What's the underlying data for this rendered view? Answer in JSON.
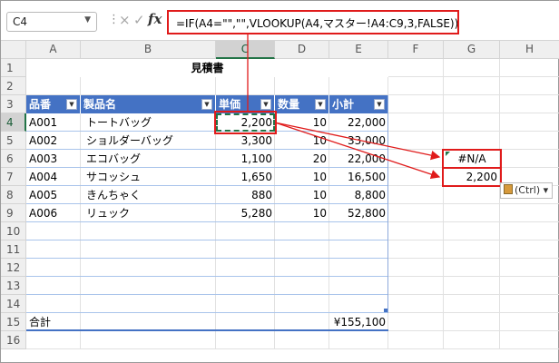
{
  "formula_bar": {
    "name_box": "C4",
    "formula": "=IF(A4=\"\",\"\",VLOOKUP(A4,マスター!A4:C9,3,FALSE))",
    "fx_label": "fx",
    "cancel_icon": "×",
    "enter_icon": "✓"
  },
  "columns": [
    "A",
    "B",
    "C",
    "D",
    "E",
    "F",
    "G",
    "H"
  ],
  "rows": [
    "1",
    "2",
    "3",
    "4",
    "5",
    "6",
    "7",
    "8",
    "9",
    "10",
    "11",
    "12",
    "13",
    "14",
    "15",
    "16"
  ],
  "sheet": {
    "title": "見積書",
    "table_headers": [
      "品番",
      "製品名",
      "単価",
      "数量",
      "小計"
    ],
    "rows": [
      {
        "code": "A001",
        "name": "トートバッグ",
        "price": "2,200",
        "qty": "10",
        "subtotal": "22,000"
      },
      {
        "code": "A002",
        "name": "ショルダーバッグ",
        "price": "3,300",
        "qty": "10",
        "subtotal": "33,000"
      },
      {
        "code": "A003",
        "name": "エコバッグ",
        "price": "1,100",
        "qty": "20",
        "subtotal": "22,000"
      },
      {
        "code": "A004",
        "name": "サコッシュ",
        "price": "1,650",
        "qty": "10",
        "subtotal": "16,500"
      },
      {
        "code": "A005",
        "name": "きんちゃく",
        "price": "880",
        "qty": "10",
        "subtotal": "8,800"
      },
      {
        "code": "A006",
        "name": "リュック",
        "price": "5,280",
        "qty": "10",
        "subtotal": "52,800"
      }
    ],
    "total_label": "合計",
    "total_value": "¥155,100",
    "pasted_values": [
      "#N/A",
      "2,200"
    ],
    "paste_options_label": "(Ctrl)",
    "selected_cell": "C4"
  },
  "colors": {
    "table_header": "#4472c4",
    "highlight_red": "#e01b1b",
    "selection_green": "#217346"
  }
}
